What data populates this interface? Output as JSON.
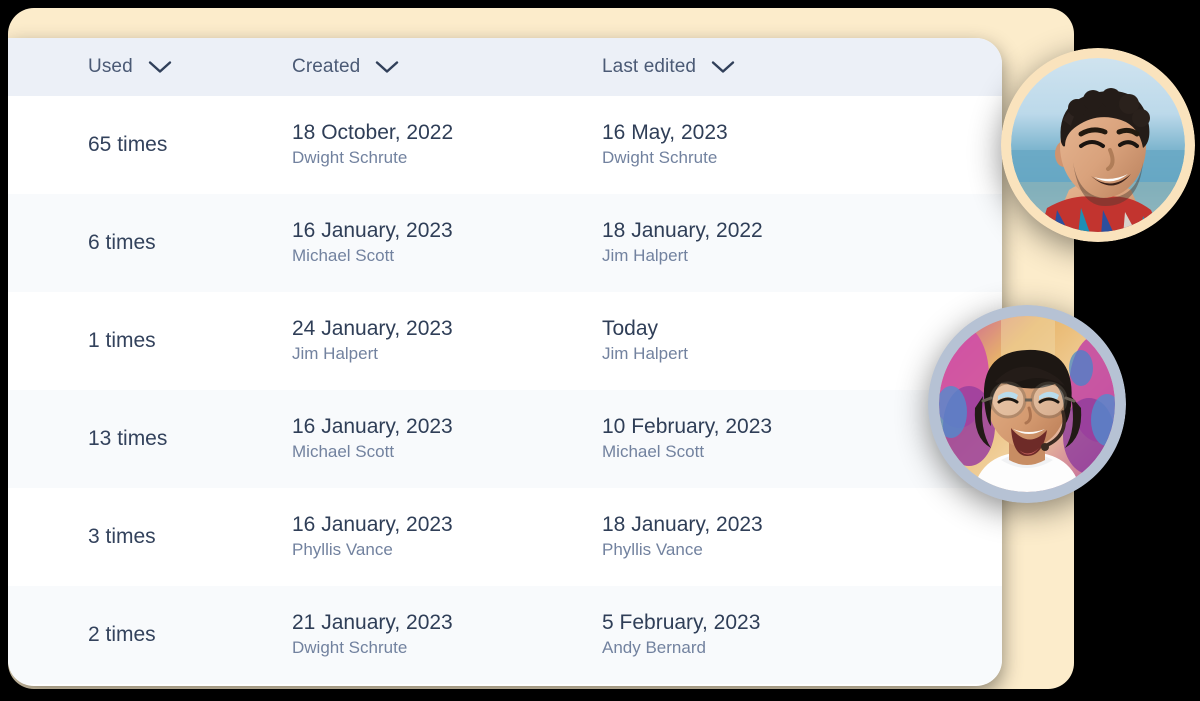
{
  "theme": {
    "backdrop_color": "#fceccb",
    "card_color": "#ffffff",
    "header_bg_color": "#ecf0f7",
    "row_alt_color": "#f8fafc",
    "primary_text_color": "#2f3e57",
    "secondary_text_color": "#72829f",
    "header_text_color": "#4b5a75",
    "avatar_1_ring_color": "#fae3bd",
    "avatar_2_ring_color": "#b6c2d4"
  },
  "table": {
    "columns": [
      {
        "label": "Used",
        "sort_icon": "chevron-down-icon"
      },
      {
        "label": "Created",
        "sort_icon": "chevron-down-icon"
      },
      {
        "label": "Last edited",
        "sort_icon": "chevron-down-icon"
      }
    ],
    "rows": [
      {
        "used": "65 times",
        "created_date": "18 October, 2022",
        "created_by": "Dwight Schrute",
        "edited_date": "16 May, 2023",
        "edited_by": "Dwight Schrute"
      },
      {
        "used": "6 times",
        "created_date": "16 January, 2023",
        "created_by": "Michael Scott",
        "edited_date": "18 January, 2022",
        "edited_by": "Jim Halpert"
      },
      {
        "used": "1 times",
        "created_date": "24 January, 2023",
        "created_by": "Jim Halpert",
        "edited_date": "Today",
        "edited_by": "Jim Halpert"
      },
      {
        "used": "13 times",
        "created_date": "16 January, 2023",
        "created_by": "Michael Scott",
        "edited_date": "10 February, 2023",
        "edited_by": "Michael Scott"
      },
      {
        "used": "3 times",
        "created_date": "16 January, 2023",
        "created_by": "Phyllis Vance",
        "edited_date": "18 January, 2023",
        "edited_by": "Phyllis Vance"
      },
      {
        "used": "2 times",
        "created_date": "21 January, 2023",
        "created_by": "Dwight Schrute",
        "edited_date": "5 February, 2023",
        "edited_by": "Andy Bernard"
      }
    ]
  },
  "avatars": [
    {
      "name": "avatar-smiling-man",
      "description": "Smiling man with dark curly hair, beach background, red and blue patterned shirt",
      "ring_color": "#fae3bd"
    },
    {
      "name": "avatar-laughing-woman",
      "description": "Laughing woman with glasses, dark bob hair, white turtleneck, pink and blue tie-dye background",
      "ring_color": "#b6c2d4"
    }
  ]
}
